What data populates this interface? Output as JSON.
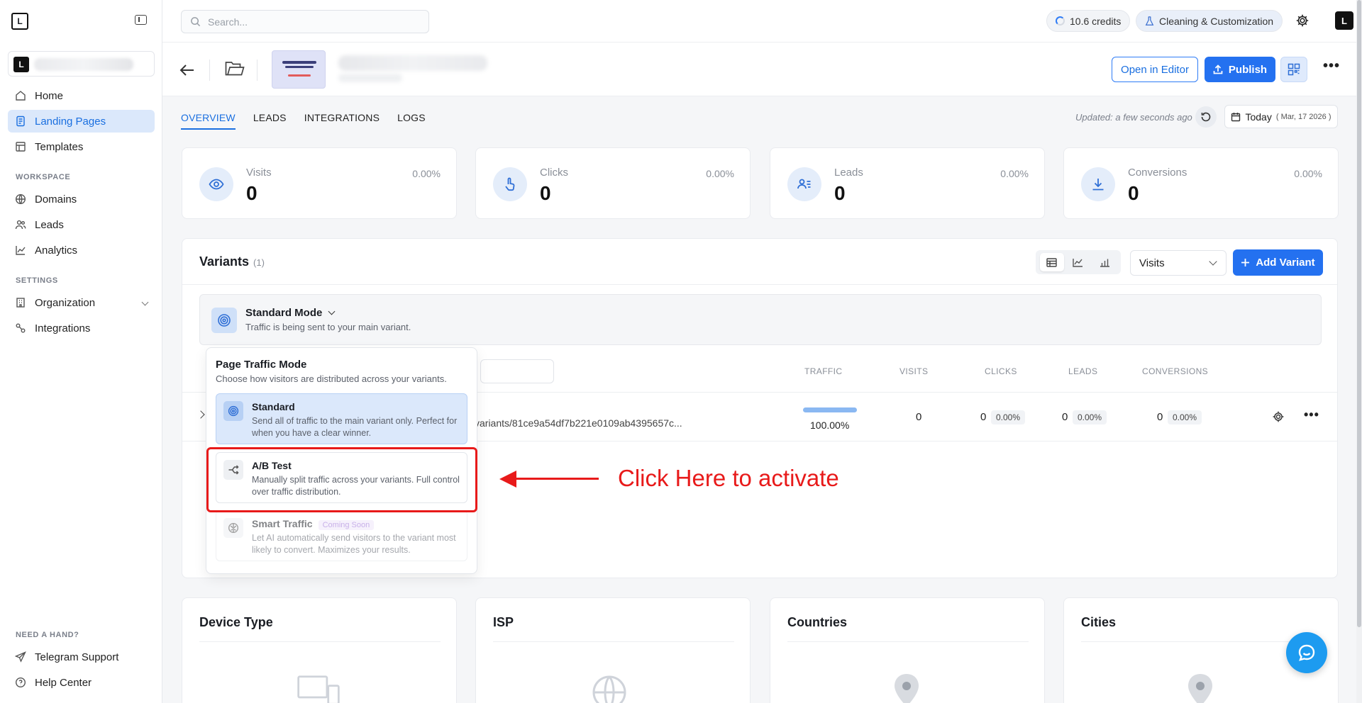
{
  "sidebar": {
    "nav": [
      {
        "label": "Home",
        "icon": "home-icon"
      },
      {
        "label": "Landing Pages",
        "icon": "document-icon",
        "active": true
      },
      {
        "label": "Templates",
        "icon": "template-icon"
      }
    ],
    "workspace_label": "WORKSPACE",
    "workspace": [
      {
        "label": "Domains",
        "icon": "globe-icon"
      },
      {
        "label": "Leads",
        "icon": "users-icon"
      },
      {
        "label": "Analytics",
        "icon": "chart-line-icon"
      }
    ],
    "settings_label": "SETTINGS",
    "settings": [
      {
        "label": "Organization",
        "icon": "building-icon"
      },
      {
        "label": "Integrations",
        "icon": "integrations-icon"
      }
    ],
    "help_label": "NEED A HAND?",
    "help": [
      {
        "label": "Telegram Support",
        "icon": "send-icon"
      },
      {
        "label": "Help Center",
        "icon": "help-circle-icon"
      }
    ]
  },
  "topbar": {
    "search_placeholder": "Search...",
    "credits": "10.6 credits",
    "workspace_pill": "Cleaning & Customization"
  },
  "header": {
    "open_editor": "Open in Editor",
    "publish": "Publish"
  },
  "tabs": [
    "OVERVIEW",
    "LEADS",
    "INTEGRATIONS",
    "LOGS"
  ],
  "updated": "Updated: a few seconds ago",
  "date": {
    "label": "Today",
    "detail": "( Mar, 17 2026 )"
  },
  "stats": [
    {
      "label": "Visits",
      "value": "0",
      "pct": "0.00%",
      "icon": "eye-icon"
    },
    {
      "label": "Clicks",
      "value": "0",
      "pct": "0.00%",
      "icon": "pointer-icon"
    },
    {
      "label": "Leads",
      "value": "0",
      "pct": "0.00%",
      "icon": "user-list-icon"
    },
    {
      "label": "Conversions",
      "value": "0",
      "pct": "0.00%",
      "icon": "download-icon"
    }
  ],
  "variants": {
    "title": "Variants",
    "count": "(1)",
    "metric_select": "Visits",
    "add_button": "Add Variant",
    "mode_title": "Standard Mode",
    "mode_sub": "Traffic is being sent to your main variant.",
    "columns": [
      "TRAFFIC",
      "VISITS",
      "CLICKS",
      "LEADS",
      "CONVERSIONS"
    ],
    "row": {
      "url": "variants/81ce9a54df7b221e0109ab4395657c...",
      "traffic_pct": 1.0,
      "traffic": "100.00%",
      "visits": "0",
      "clicks": "0",
      "clicks_pct": "0.00%",
      "leads": "0",
      "leads_pct": "0.00%",
      "conversions": "0",
      "conversions_pct": "0.00%"
    }
  },
  "popover": {
    "title": "Page Traffic Mode",
    "subtitle": "Choose how visitors are distributed across your variants.",
    "options": [
      {
        "title": "Standard",
        "desc": "Send all of traffic to the main variant only. Perfect for when you have a clear winner.",
        "state": "selected"
      },
      {
        "title": "A/B Test",
        "desc": "Manually split traffic across your variants. Full control over traffic distribution.",
        "state": "normal"
      },
      {
        "title": "Smart Traffic",
        "badge": "Coming Soon",
        "desc": "Let AI automatically send visitors to the variant most likely to convert. Maximizes your results.",
        "state": "disabled"
      }
    ]
  },
  "annotation": {
    "text": "Click Here to activate",
    "color": "#e81a1a"
  },
  "bottom_cards": [
    "Device Type",
    "ISP",
    "Countries",
    "Cities"
  ],
  "colors": {
    "accent": "#2471f0",
    "active_bg": "#dbe8fb",
    "annotation": "#e81a1a"
  }
}
